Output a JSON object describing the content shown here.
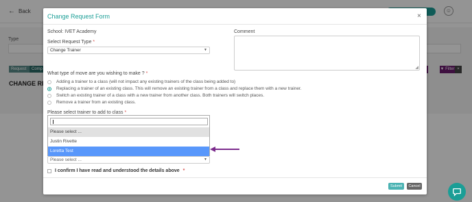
{
  "background": {
    "back_label": "Back",
    "type_label": "Type",
    "heading": "CHANGE REQU",
    "tab1": "Request",
    "tab2": "Comp",
    "filter_label": "Filter",
    "filter_clear": "×"
  },
  "modal": {
    "title": "Change Request Form",
    "close": "×",
    "school": "School: IVET Academy",
    "request_type_label": "Select Request Type",
    "request_type_value": "Change Trainer",
    "comment_label": "Comment",
    "comment_value": "",
    "move_question": "What type of move are you wishing to make ?",
    "move_options": [
      {
        "label": "Adding a trainer to a class (will not impact any existing trainers of the class being added to)",
        "checked": false
      },
      {
        "label": "Replacing a trainer of an existing class. This will remove an existing trainer from a class and replace them with a new trainer.",
        "checked": true
      },
      {
        "label": "Switch an existing trainer of a class with a new trainer from another class. Both trainers will switch places.",
        "checked": false
      },
      {
        "label": "Remove a trainer from an existing class.",
        "checked": false
      }
    ],
    "trainer_label": "Please select trainer to add to class",
    "dropdown": {
      "search_value": "",
      "options": [
        "Please select ...",
        "Justin Rivette",
        "Loretta Test"
      ],
      "highlighted": "Loretta Test"
    },
    "second_select_placeholder": "Please select ...",
    "confirm_label": "I confirm I have read and understood the details above",
    "required_mark": "*",
    "submit_label": "Submit",
    "cancel_label": "Cancel"
  },
  "colors": {
    "accent": "#1a9e96",
    "highlight": "#5897fb",
    "annotation": "#7b2a8c"
  }
}
